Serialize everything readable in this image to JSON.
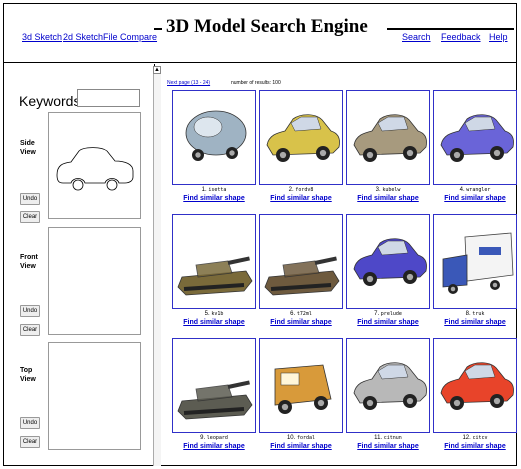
{
  "header": {
    "links_left": [
      "3d Sketch",
      "2d Sketch",
      "File Compare"
    ],
    "title": "3D Model Search Engine",
    "links_right": [
      "Search",
      "Feedback",
      "Help"
    ]
  },
  "sidebar": {
    "keywords_label": "Keywords:",
    "keywords_value": "",
    "sections": [
      {
        "label_lines": [
          "Side",
          "View"
        ],
        "undo": "Undo",
        "clear": "Clear"
      },
      {
        "label_lines": [
          "Front",
          "View"
        ],
        "undo": "Undo",
        "clear": "Clear"
      },
      {
        "label_lines": [
          "Top",
          "View"
        ],
        "undo": "Undo",
        "clear": "Clear"
      }
    ]
  },
  "results": {
    "next_page": "Next page (13 - 24)",
    "count_text": "number of results: 100",
    "find_similar": "Find similar shape",
    "items": [
      {
        "num": "1.",
        "name": "isetta",
        "icon": "bubble-car-icon",
        "color": "#9fb3c3"
      },
      {
        "num": "2.",
        "name": "fordv8",
        "icon": "vintage-car-icon",
        "color": "#d8c24a"
      },
      {
        "num": "3.",
        "name": "kubelw",
        "icon": "military-car-icon",
        "color": "#a79a7e"
      },
      {
        "num": "4.",
        "name": "wrangler",
        "icon": "jeep-icon",
        "color": "#6a64d8"
      },
      {
        "num": "5.",
        "name": "kv1b",
        "icon": "tank-icon",
        "color": "#7a6a3a"
      },
      {
        "num": "6.",
        "name": "t72ml",
        "icon": "tank-icon",
        "color": "#6e5a3e"
      },
      {
        "num": "7.",
        "name": "prelude",
        "icon": "sedan-icon",
        "color": "#4e48c8"
      },
      {
        "num": "8.",
        "name": "truk",
        "icon": "truck-icon",
        "color": "#3a58b8"
      },
      {
        "num": "9.",
        "name": "leopard",
        "icon": "tank-icon",
        "color": "#5c5c52"
      },
      {
        "num": "10.",
        "name": "fordal",
        "icon": "van-icon",
        "color": "#d89a3a"
      },
      {
        "num": "11.",
        "name": "citnun",
        "icon": "car-icon",
        "color": "#b8b8b8"
      },
      {
        "num": "12.",
        "name": "citcv",
        "icon": "car-icon",
        "color": "#e8442a"
      }
    ]
  }
}
